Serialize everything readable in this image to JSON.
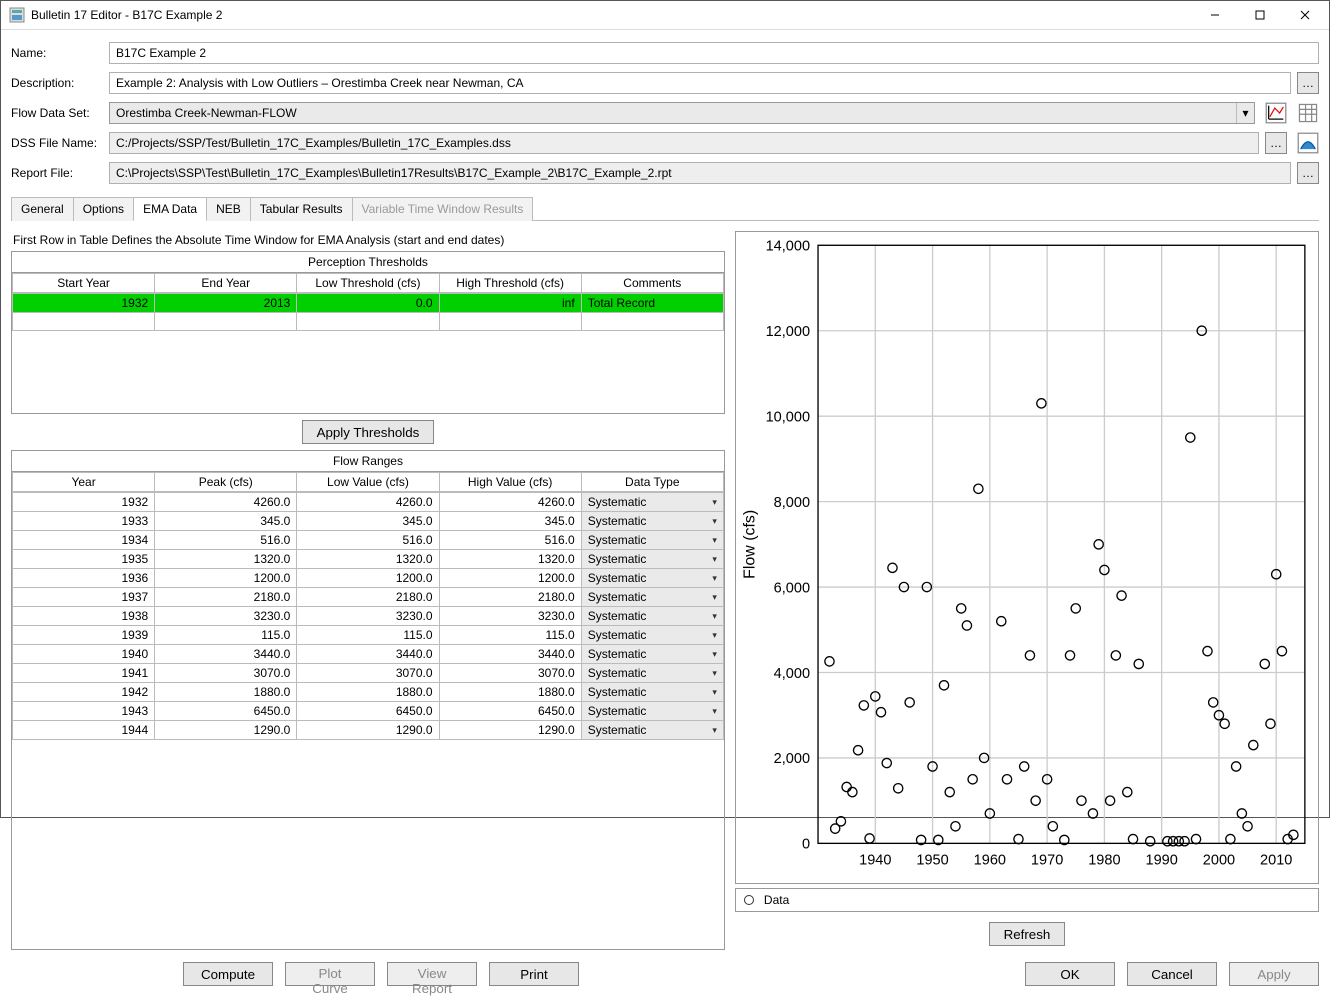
{
  "window": {
    "title": "Bulletin 17 Editor - B17C Example 2"
  },
  "form": {
    "name_label": "Name:",
    "name_value": "B17C Example 2",
    "desc_label": "Description:",
    "desc_value": "Example 2: Analysis with Low Outliers – Orestimba Creek near Newman, CA",
    "flowds_label": "Flow Data Set:",
    "flowds_value": "Orestimba Creek-Newman-FLOW",
    "dss_label": "DSS File Name:",
    "dss_value": "C:/Projects/SSP/Test/Bulletin_17C_Examples/Bulletin_17C_Examples.dss",
    "report_label": "Report File:",
    "report_value": "C:\\Projects\\SSP\\Test\\Bulletin_17C_Examples\\Bulletin17Results\\B17C_Example_2\\B17C_Example_2.rpt"
  },
  "tabs": {
    "items": [
      "General",
      "Options",
      "EMA Data",
      "NEB",
      "Tabular Results",
      "Variable Time Window Results"
    ],
    "active": "EMA Data",
    "disabled": [
      "Variable Time Window Results"
    ]
  },
  "ema": {
    "hint": "First Row in Table Defines the Absolute Time Window for EMA Analysis (start and end dates)",
    "pt_title": "Perception Thresholds",
    "pt_cols": [
      "Start Year",
      "End Year",
      "Low Threshold (cfs)",
      "High Threshold (cfs)",
      "Comments"
    ],
    "pt_row": {
      "start": "1932",
      "end": "2013",
      "low": "0.0",
      "high": "inf",
      "comments": "Total Record"
    },
    "apply_label": "Apply Thresholds",
    "fr_title": "Flow Ranges",
    "fr_cols": [
      "Year",
      "Peak (cfs)",
      "Low Value (cfs)",
      "High Value (cfs)",
      "Data Type"
    ],
    "fr_rows": [
      {
        "year": "1932",
        "peak": "4260.0",
        "low": "4260.0",
        "high": "4260.0",
        "type": "Systematic"
      },
      {
        "year": "1933",
        "peak": "345.0",
        "low": "345.0",
        "high": "345.0",
        "type": "Systematic"
      },
      {
        "year": "1934",
        "peak": "516.0",
        "low": "516.0",
        "high": "516.0",
        "type": "Systematic"
      },
      {
        "year": "1935",
        "peak": "1320.0",
        "low": "1320.0",
        "high": "1320.0",
        "type": "Systematic"
      },
      {
        "year": "1936",
        "peak": "1200.0",
        "low": "1200.0",
        "high": "1200.0",
        "type": "Systematic"
      },
      {
        "year": "1937",
        "peak": "2180.0",
        "low": "2180.0",
        "high": "2180.0",
        "type": "Systematic"
      },
      {
        "year": "1938",
        "peak": "3230.0",
        "low": "3230.0",
        "high": "3230.0",
        "type": "Systematic"
      },
      {
        "year": "1939",
        "peak": "115.0",
        "low": "115.0",
        "high": "115.0",
        "type": "Systematic"
      },
      {
        "year": "1940",
        "peak": "3440.0",
        "low": "3440.0",
        "high": "3440.0",
        "type": "Systematic"
      },
      {
        "year": "1941",
        "peak": "3070.0",
        "low": "3070.0",
        "high": "3070.0",
        "type": "Systematic"
      },
      {
        "year": "1942",
        "peak": "1880.0",
        "low": "1880.0",
        "high": "1880.0",
        "type": "Systematic"
      },
      {
        "year": "1943",
        "peak": "6450.0",
        "low": "6450.0",
        "high": "6450.0",
        "type": "Systematic"
      },
      {
        "year": "1944",
        "peak": "1290.0",
        "low": "1290.0",
        "high": "1290.0",
        "type": "Systematic"
      }
    ]
  },
  "chart_ui": {
    "ylabel": "Flow (cfs)",
    "legend_text": "Data",
    "refresh_label": "Refresh"
  },
  "buttons": {
    "compute": "Compute",
    "plot": "Plot Curve",
    "view": "View Report",
    "print": "Print",
    "ok": "OK",
    "cancel": "Cancel",
    "apply": "Apply"
  },
  "chart_data": {
    "type": "scatter",
    "xlabel": "",
    "ylabel": "Flow (cfs)",
    "xlim": [
      1930,
      2015
    ],
    "ylim": [
      0,
      14000
    ],
    "x_ticks": [
      1940,
      1950,
      1960,
      1970,
      1980,
      1990,
      2000,
      2010
    ],
    "y_ticks": [
      0,
      2000,
      4000,
      6000,
      8000,
      10000,
      12000,
      14000
    ],
    "series": [
      {
        "name": "Data",
        "x": [
          1932,
          1933,
          1934,
          1935,
          1936,
          1937,
          1938,
          1939,
          1940,
          1941,
          1942,
          1943,
          1944,
          1945,
          1946,
          1948,
          1949,
          1950,
          1951,
          1952,
          1953,
          1954,
          1955,
          1956,
          1957,
          1958,
          1959,
          1960,
          1962,
          1963,
          1965,
          1966,
          1967,
          1968,
          1969,
          1970,
          1971,
          1973,
          1974,
          1975,
          1976,
          1978,
          1979,
          1980,
          1981,
          1982,
          1983,
          1984,
          1985,
          1986,
          1988,
          1991,
          1992,
          1993,
          1994,
          1995,
          1996,
          1997,
          1998,
          1999,
          2000,
          2001,
          2002,
          2003,
          2004,
          2005,
          2006,
          2008,
          2009,
          2010,
          2011,
          2012,
          2013
        ],
        "y": [
          4260,
          345,
          516,
          1320,
          1200,
          2180,
          3230,
          115,
          3440,
          3070,
          1880,
          6450,
          1290,
          6000,
          3300,
          80,
          6000,
          1800,
          80,
          3700,
          1200,
          400,
          5500,
          5100,
          1500,
          8300,
          2000,
          700,
          5200,
          1500,
          100,
          1800,
          4400,
          1000,
          10300,
          1500,
          400,
          80,
          4400,
          5500,
          1000,
          700,
          7000,
          6400,
          1000,
          4400,
          5800,
          1200,
          100,
          4200,
          50,
          50,
          50,
          50,
          50,
          9500,
          100,
          12000,
          4500,
          3300,
          3000,
          2800,
          100,
          1800,
          700,
          400,
          2300,
          4200,
          2800,
          6300,
          4500,
          100,
          200
        ]
      }
    ]
  }
}
